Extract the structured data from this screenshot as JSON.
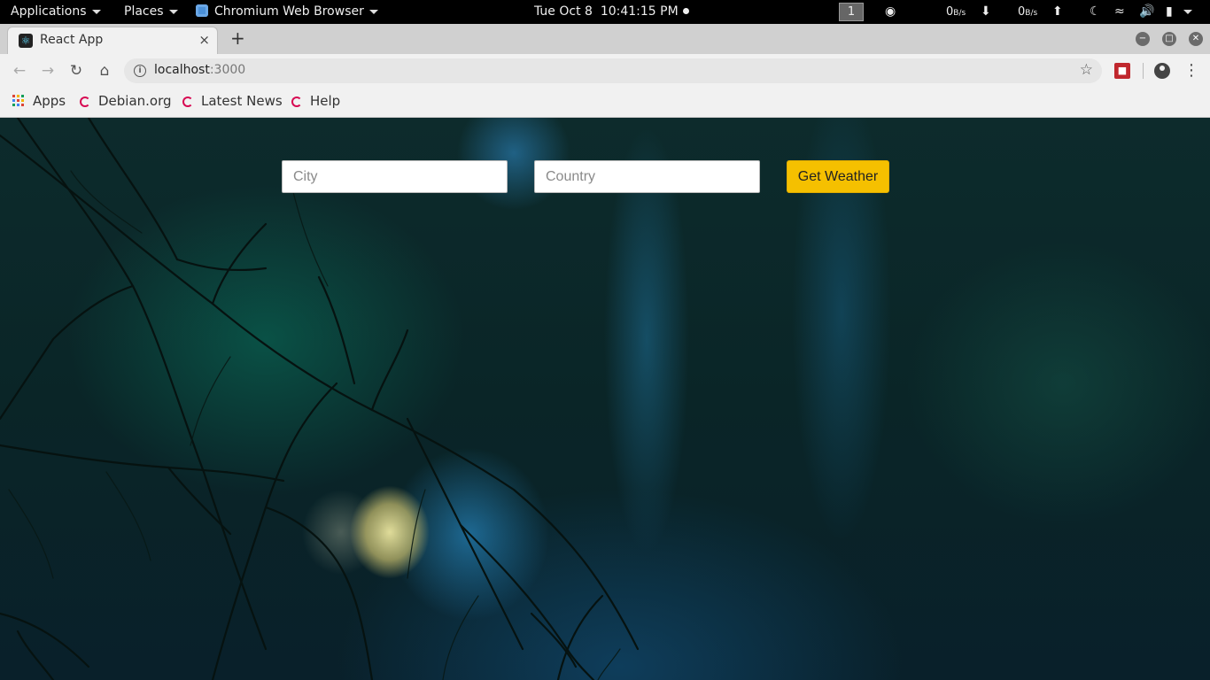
{
  "os_panel": {
    "applications": "Applications",
    "places": "Places",
    "active_app": "Chromium Web Browser",
    "clock": "Tue Oct 8  10:41:15 PM",
    "workspace": "1",
    "net_down_value": "0",
    "net_down_unit": "B/s",
    "net_up_value": "0",
    "net_up_unit": "B/s"
  },
  "browser": {
    "tab": {
      "title": "React App",
      "close": "×"
    },
    "new_tab": "+",
    "address": {
      "host": "localhost",
      "port": ":3000"
    },
    "bookmarks": [
      {
        "label": "Apps"
      },
      {
        "label": "Debian.org"
      },
      {
        "label": "Latest News"
      },
      {
        "label": "Help"
      }
    ]
  },
  "weather_form": {
    "city_placeholder": "City",
    "country_placeholder": "Country",
    "submit_label": "Get Weather",
    "city_value": "",
    "country_value": ""
  },
  "colors": {
    "button_accent": "#f5c000",
    "panel_bg": "#000000",
    "browser_chrome": "#f1f1f1"
  }
}
